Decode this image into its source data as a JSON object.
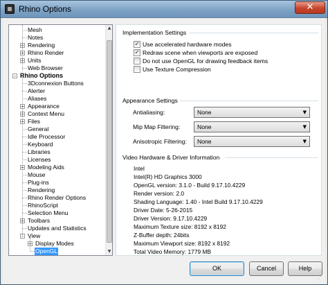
{
  "window": {
    "title": "Rhino Options",
    "close_glyph": "✕"
  },
  "tree": {
    "items": [
      {
        "label": "Mesh",
        "expander": ""
      },
      {
        "label": "Notes",
        "expander": ""
      },
      {
        "label": "Rendering",
        "expander": "+"
      },
      {
        "label": "Rhino Render",
        "expander": "+"
      },
      {
        "label": "Units",
        "expander": "+"
      },
      {
        "label": "Web Browser",
        "expander": ""
      },
      {
        "label": "Rhino Options",
        "expander": "−"
      },
      {
        "label": "3Dconnexion Buttons",
        "expander": ""
      },
      {
        "label": "Alerter",
        "expander": ""
      },
      {
        "label": "Aliases",
        "expander": ""
      },
      {
        "label": "Appearance",
        "expander": "+"
      },
      {
        "label": "Context Menu",
        "expander": "+"
      },
      {
        "label": "Files",
        "expander": "+"
      },
      {
        "label": "General",
        "expander": ""
      },
      {
        "label": "Idle Processor",
        "expander": ""
      },
      {
        "label": "Keyboard",
        "expander": ""
      },
      {
        "label": "Libraries",
        "expander": ""
      },
      {
        "label": "Licenses",
        "expander": ""
      },
      {
        "label": "Modeling Aids",
        "expander": "+"
      },
      {
        "label": "Mouse",
        "expander": ""
      },
      {
        "label": "Plug-ins",
        "expander": ""
      },
      {
        "label": "Rendering",
        "expander": ""
      },
      {
        "label": "Rhino Render Options",
        "expander": ""
      },
      {
        "label": "RhinoScript",
        "expander": ""
      },
      {
        "label": "Selection Menu",
        "expander": ""
      },
      {
        "label": "Toolbars",
        "expander": "+"
      },
      {
        "label": "Updates and Statistics",
        "expander": ""
      },
      {
        "label": "View",
        "expander": "−"
      },
      {
        "label": "Display Modes",
        "expander": "+"
      },
      {
        "label": "OpenGL",
        "expander": ""
      }
    ],
    "selected": "OpenGL"
  },
  "implementation": {
    "title": "Implementation Settings",
    "options": [
      {
        "label": "Use accelerated hardware modes",
        "checked": true,
        "mark": "✓"
      },
      {
        "label": "Redraw scene when viewports are exposed",
        "checked": true,
        "mark": "✓"
      },
      {
        "label": "Do not use OpenGL for drawing feedback items",
        "checked": false,
        "mark": ""
      },
      {
        "label": "Use Texture Compression",
        "checked": false,
        "mark": ""
      }
    ]
  },
  "appearance": {
    "title": "Appearance Settings",
    "fields": [
      {
        "label": "Antialiasing:",
        "value": "None"
      },
      {
        "label": "Mip Map Filtering:",
        "value": "None"
      },
      {
        "label": "Anisotropic Filtering:",
        "value": "None"
      }
    ],
    "arrow_glyph": "▼"
  },
  "video": {
    "title": "Video Hardware & Driver Information",
    "lines": [
      "Intel",
      "Intel(R) HD Graphics 3000",
      "OpenGL version: 3.1.0 - Build 9.17.10.4229",
      "Render version: 2.0",
      "Shading Language: 1.40 - Intel Build 9.17.10.4229",
      "Driver Date: 5-26-2015",
      "Driver Version: 9.17.10.4229",
      "Maximum Texture size: 8192 x 8192",
      "Z-Buffer depth: 24bits",
      "Maximum Viewport size: 8192 x 8192",
      "Total Video Memory: 1779 MB"
    ]
  },
  "buttons": {
    "ok": "OK",
    "cancel": "Cancel",
    "help": "Help"
  },
  "icons": {
    "scroll_up": "▲",
    "scroll_down": "▼",
    "resize_grip": "⋰"
  }
}
